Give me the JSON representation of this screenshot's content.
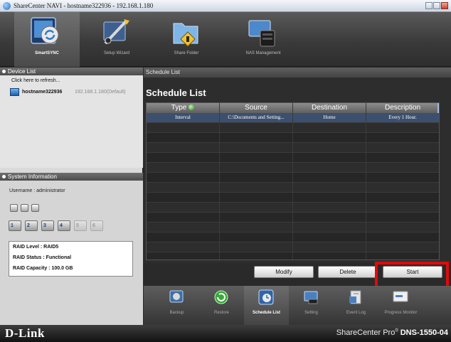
{
  "window": {
    "title": "ShareCenter NAVI - hostname322936 - 192.168.1.180"
  },
  "toolbar": {
    "items": [
      {
        "label": "SmartSYNC",
        "icon": "sync-computer-icon",
        "active": true
      },
      {
        "label": "Setup Wizard",
        "icon": "wand-tools-icon",
        "active": false
      },
      {
        "label": "Share Folder",
        "icon": "share-folder-icon",
        "active": false
      },
      {
        "label": "NAS Management",
        "icon": "nas-management-icon",
        "active": false
      }
    ]
  },
  "device_list": {
    "header": "Device List",
    "refresh_text": "Click here to refresh...",
    "device": {
      "name": "hostname322936",
      "ip": "192.168.1.180(Default)"
    }
  },
  "system_information": {
    "header": "System Information",
    "username": "Username : administrator",
    "disks": [
      "1",
      "2",
      "3",
      "4",
      "5",
      "6"
    ],
    "raid_level": "RAID Level : RAID5",
    "raid_status": "RAID Status : Functional",
    "raid_capacity": "RAID Capacity : 100.0 GB"
  },
  "schedule": {
    "breadcrumb": "Schedule List",
    "title": "Schedule List",
    "columns": [
      "Type",
      "Source",
      "Destination",
      "Description"
    ],
    "rows": [
      [
        "Interval",
        "C:\\Documents and Setting...",
        "Home",
        "Every 1 Hour."
      ]
    ],
    "buttons": {
      "modify": "Modify",
      "delete": "Delete",
      "start": "Start"
    }
  },
  "taskbar": {
    "items": [
      {
        "label": "Backup",
        "active": false
      },
      {
        "label": "Restore",
        "active": false
      },
      {
        "label": "Schedule List",
        "active": true
      },
      {
        "label": "Setting",
        "active": false
      },
      {
        "label": "Event Log",
        "active": false
      },
      {
        "label": "Progress Monitor",
        "active": false
      }
    ]
  },
  "footer": {
    "brand": "D-Link",
    "product": "ShareCenter Pro",
    "trademark": "®",
    "model": "DNS-1550-04"
  },
  "colors": {
    "highlight": "#e10a0a",
    "selected_row": "#3c4f6e",
    "panel_dark": "#2d2d2d"
  }
}
